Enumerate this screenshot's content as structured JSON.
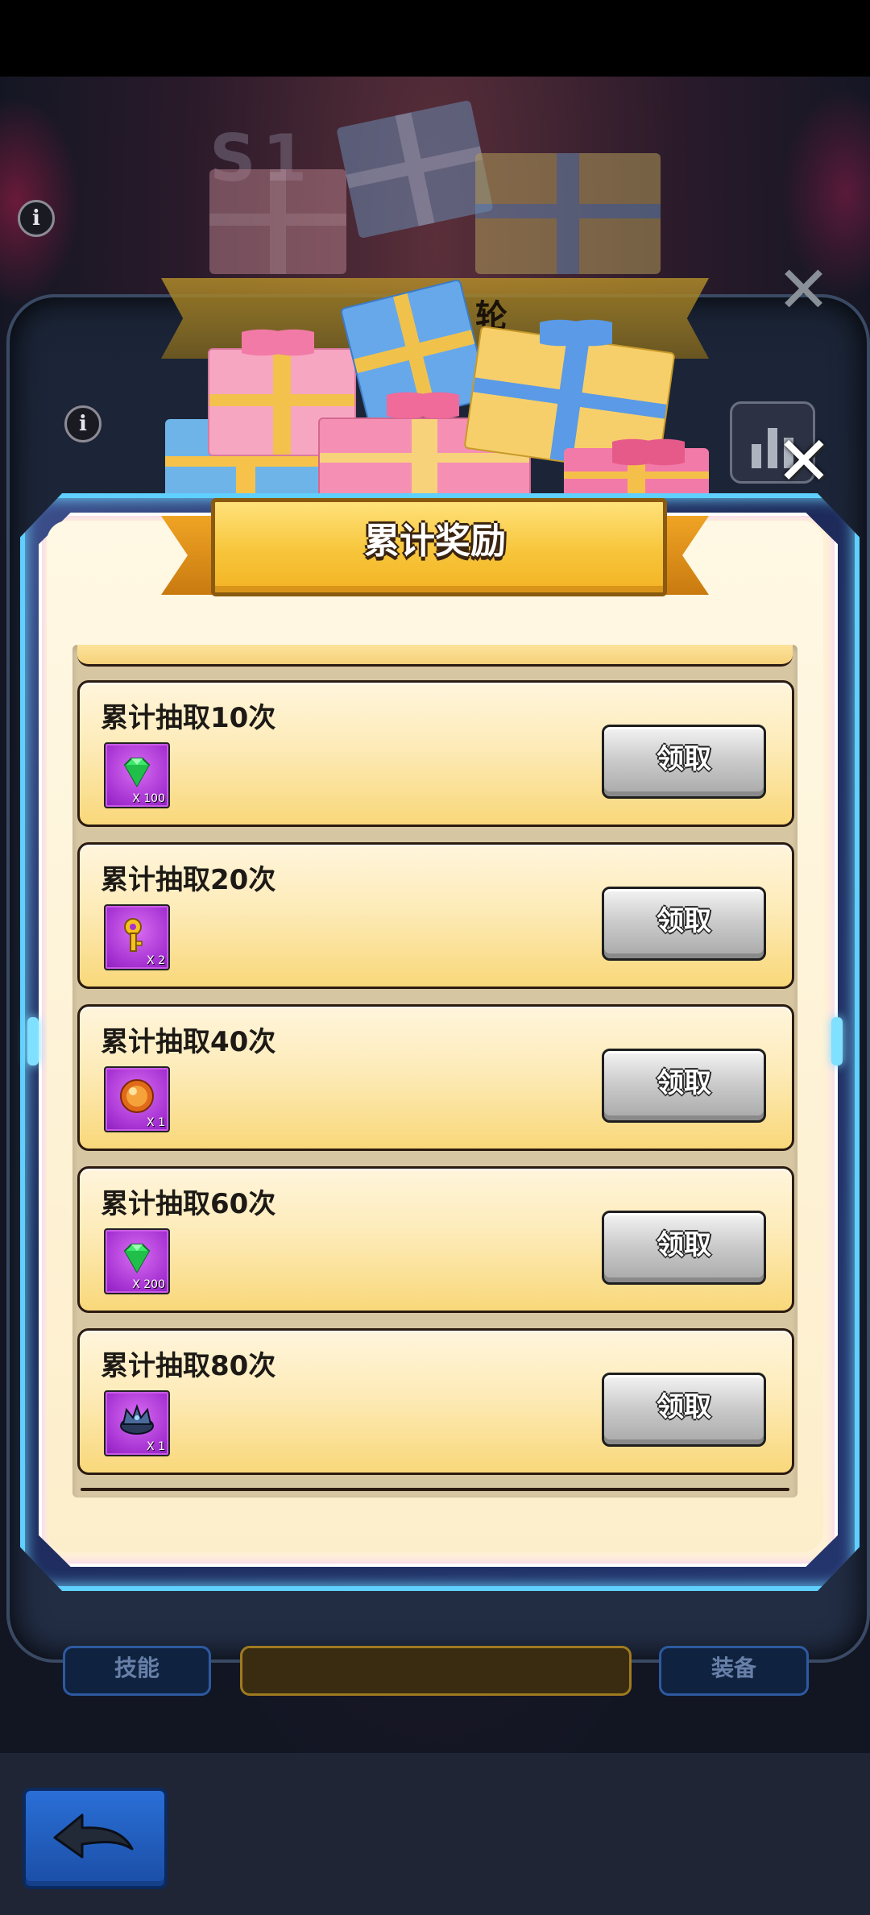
{
  "background": {
    "title": "S1",
    "banner_text": "轮",
    "bottom_buttons": [
      "技能",
      "",
      "装备"
    ]
  },
  "popup": {
    "title": "累计奖励",
    "rewards": [
      {
        "title": "累计抽取10次",
        "item": "gem-icon",
        "qty": "X 100",
        "button": "领取"
      },
      {
        "title": "累计抽取20次",
        "item": "key-icon",
        "qty": "X 2",
        "button": "领取"
      },
      {
        "title": "累计抽取40次",
        "item": "orb-icon",
        "qty": "X 1",
        "button": "领取"
      },
      {
        "title": "累计抽取60次",
        "item": "gem-icon",
        "qty": "X 200",
        "button": "领取"
      },
      {
        "title": "累计抽取80次",
        "item": "crown-icon",
        "qty": "X 1",
        "button": "领取"
      }
    ]
  },
  "icons": {
    "close": "close-icon",
    "info": "info-icon",
    "back": "back-arrow-icon",
    "stats": "bar-chart-icon"
  },
  "colors": {
    "frame_glow": "#5fd0ff",
    "banner_gold": "#f7c53a",
    "item_purple": "#a632d2",
    "claim_gray": "#c9c9c9"
  }
}
